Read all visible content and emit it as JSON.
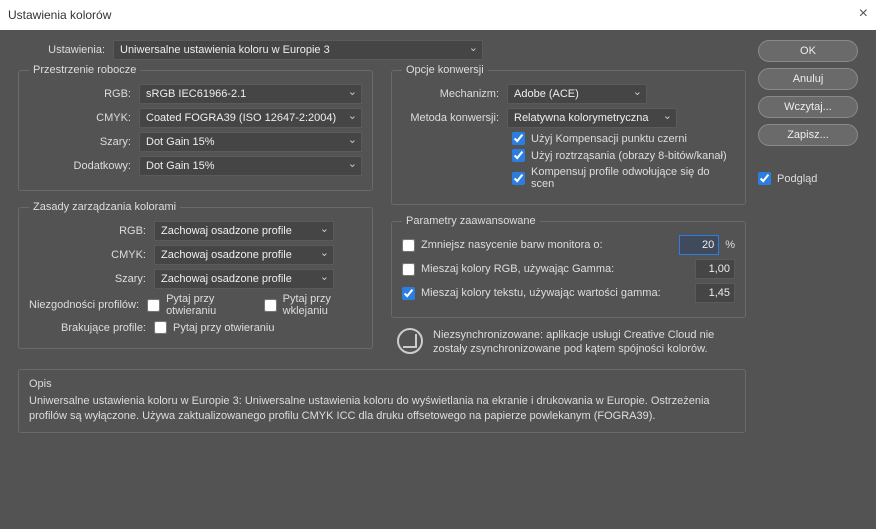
{
  "title": "Ustawienia kolorów",
  "settings": {
    "label": "Ustawienia:",
    "value": "Uniwersalne ustawienia koloru w Europie 3"
  },
  "workspaces": {
    "legend": "Przestrzenie robocze",
    "rgb": {
      "label": "RGB:",
      "value": "sRGB IEC61966-2.1"
    },
    "cmyk": {
      "label": "CMYK:",
      "value": "Coated FOGRA39 (ISO 12647-2:2004)"
    },
    "gray": {
      "label": "Szary:",
      "value": "Dot Gain 15%"
    },
    "spot": {
      "label": "Dodatkowy:",
      "value": "Dot Gain 15%"
    }
  },
  "management": {
    "legend": "Zasady zarządzania kolorami",
    "rgb": {
      "label": "RGB:",
      "value": "Zachowaj osadzone profile"
    },
    "cmyk": {
      "label": "CMYK:",
      "value": "Zachowaj osadzone profile"
    },
    "gray": {
      "label": "Szary:",
      "value": "Zachowaj osadzone profile"
    },
    "mismatch": {
      "label": "Niezgodności profilów:",
      "open": "Pytaj przy otwieraniu",
      "paste": "Pytaj przy wklejaniu"
    },
    "missing": {
      "label": "Brakujące profile:",
      "open": "Pytaj przy otwieraniu"
    }
  },
  "conversion": {
    "legend": "Opcje konwersji",
    "engine": {
      "label": "Mechanizm:",
      "value": "Adobe (ACE)"
    },
    "method": {
      "label": "Metoda konwersji:",
      "value": "Relatywna kolorymetryczna"
    },
    "bpc": "Użyj Kompensacji punktu czerni",
    "dither": "Użyj roztrząsania (obrazy 8-bitów/kanał)",
    "scene": "Kompensuj profile odwołujące się do scen"
  },
  "advanced": {
    "legend": "Parametry zaawansowane",
    "desat": {
      "label": "Zmniejsz nasycenie barw monitora o:",
      "value": "20",
      "unit": "%"
    },
    "blendrgb": {
      "label": "Mieszaj kolory RGB, używając Gamma:",
      "value": "1,00"
    },
    "blendtext": {
      "label": "Mieszaj kolory tekstu, używając wartości gamma:",
      "value": "1,45"
    }
  },
  "sync": "Niezsynchronizowane: aplikacje usługi Creative Cloud nie zostały zsynchronizowane pod kątem spójności kolorów.",
  "description": {
    "legend": "Opis",
    "text": "Uniwersalne ustawienia koloru w Europie 3:  Uniwersalne ustawienia koloru do wyświetlania na ekranie i drukowania w Europie. Ostrzeżenia profilów są wyłączone. Używa zaktualizowanego profilu CMYK ICC dla druku offsetowego na papierze powlekanym (FOGRA39)."
  },
  "buttons": {
    "ok": "OK",
    "cancel": "Anuluj",
    "load": "Wczytaj...",
    "save": "Zapisz..."
  },
  "preview": "Podgląd"
}
